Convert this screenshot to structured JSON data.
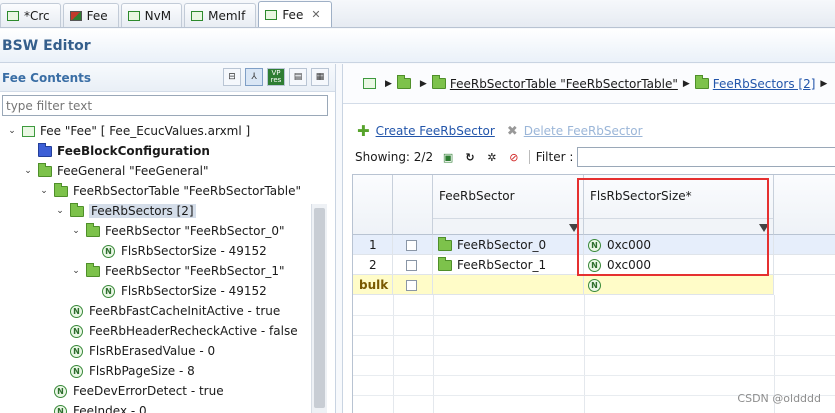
{
  "tabs": [
    {
      "label": "*Crc",
      "icon": "file-icon"
    },
    {
      "label": "Fee",
      "icon": "module-icon"
    },
    {
      "label": "NvM",
      "icon": "file-icon"
    },
    {
      "label": "MemIf",
      "icon": "file-icon"
    },
    {
      "label": "Fee",
      "icon": "file-icon",
      "active": true
    }
  ],
  "editor": {
    "title": "BSW Editor"
  },
  "left": {
    "title": "Fee Contents",
    "filter_placeholder": "type filter text",
    "tools": [
      "collapse-icon",
      "link-icon",
      "VP res",
      "doc-icon",
      "grid-icon"
    ],
    "tree": [
      {
        "label": "Fee \"Fee\" [ Fee_EcucValues.arxml ]",
        "level": 0,
        "twisty": "open",
        "icon": "doc-icon"
      },
      {
        "label": "FeeBlockConfiguration",
        "level": 1,
        "twisty": "none",
        "icon": "folder-blue-icon",
        "bold": true
      },
      {
        "label": "FeeGeneral \"FeeGeneral\"",
        "level": 1,
        "twisty": "open",
        "icon": "folder-icon"
      },
      {
        "label": "FeeRbSectorTable \"FeeRbSectorTable\"",
        "level": 2,
        "twisty": "open",
        "icon": "folder-icon"
      },
      {
        "label": "FeeRbSectors [2]",
        "level": 3,
        "twisty": "open",
        "icon": "folder-icon",
        "selected": true
      },
      {
        "label": "FeeRbSector \"FeeRbSector_0\"",
        "level": 4,
        "twisty": "open",
        "icon": "folder-icon"
      },
      {
        "label": "FlsRbSectorSize - 49152",
        "level": 5,
        "twisty": "none",
        "icon": "numeric-icon"
      },
      {
        "label": "FeeRbSector \"FeeRbSector_1\"",
        "level": 4,
        "twisty": "open",
        "icon": "folder-icon"
      },
      {
        "label": "FlsRbSectorSize - 49152",
        "level": 5,
        "twisty": "none",
        "icon": "numeric-icon"
      },
      {
        "label": "FeeRbFastCacheInitActive - true",
        "level": 3,
        "twisty": "none",
        "icon": "numeric-icon"
      },
      {
        "label": "FeeRbHeaderRecheckActive - false",
        "level": 3,
        "twisty": "none",
        "icon": "numeric-icon"
      },
      {
        "label": "FlsRbErasedValue - 0",
        "level": 3,
        "twisty": "none",
        "icon": "numeric-icon"
      },
      {
        "label": "FlsRbPageSize - 8",
        "level": 3,
        "twisty": "none",
        "icon": "numeric-icon"
      },
      {
        "label": "FeeDevErrorDetect - true",
        "level": 2,
        "twisty": "none",
        "icon": "numeric-icon"
      },
      {
        "label": "FeeIndex - 0",
        "level": 2,
        "twisty": "none",
        "icon": "numeric-icon"
      }
    ]
  },
  "right": {
    "breadcrumb": [
      {
        "label": "",
        "icon": "doc-icon"
      },
      {
        "label": "",
        "icon": "folder-icon"
      },
      {
        "label": "FeeRbSectorTable \"FeeRbSectorTable\"",
        "icon": "folder-icon"
      },
      {
        "label": "FeeRbSectors [2]",
        "icon": "folder-icon",
        "link": true
      }
    ],
    "create_label": "Create FeeRbSector",
    "delete_label": "Delete FeeRbSector",
    "showing": "Showing: 2/2",
    "filter_label": "Filter :",
    "table": {
      "columns": [
        "",
        "",
        "FeeRbSector",
        "FlsRbSectorSize*"
      ],
      "rows": [
        {
          "index": "1",
          "name": "FeeRbSector_0",
          "value": "0xc000"
        },
        {
          "index": "2",
          "name": "FeeRbSector_1",
          "value": "0xc000"
        }
      ],
      "bulk_label": "bulk"
    }
  },
  "watermark": "CSDN @oldddd",
  "colors": {
    "accent": "#355f8c",
    "highlight": "#e53030",
    "bulk": "#fffcc8"
  }
}
